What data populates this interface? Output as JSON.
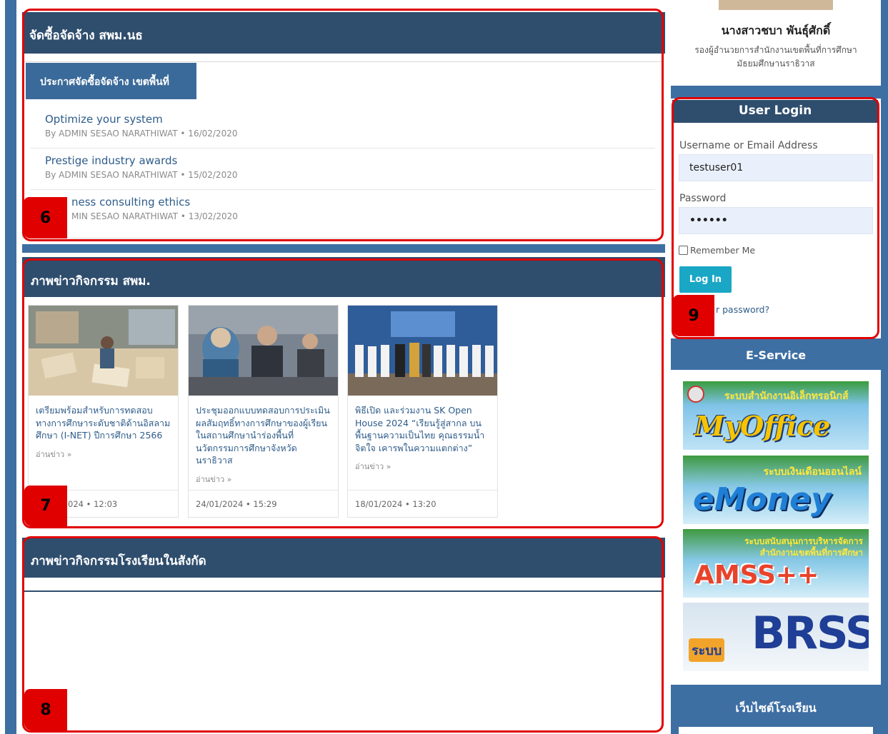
{
  "procurement": {
    "title": "จัดซื้อจัดจ้าง สพม.นธ",
    "tab": "ประกาศจัดซื้อจัดจ้าง เขตพื้นที่",
    "posts": [
      {
        "title": "Optimize your system",
        "meta": "By ADMIN SESAO NARATHIWAT • 16/02/2020"
      },
      {
        "title": "Prestige industry awards",
        "meta": "By ADMIN SESAO NARATHIWAT • 15/02/2020"
      },
      {
        "title": "ness consulting ethics",
        "meta": "MIN SESAO NARATHIWAT • 13/02/2020"
      }
    ],
    "badge": "6"
  },
  "news": {
    "title": "ภาพข่าวกิจกรรม สพม.",
    "badge": "7",
    "cards": [
      {
        "title": "เตรียมพร้อมสำหรับการทดสอบทางการศึกษาระดับชาติด้านอิสลามศึกษา (I-NET) ปีการศึกษา 2566",
        "more": "อ่านข่าว »",
        "date": "024",
        "time": "12:03"
      },
      {
        "title": "ประชุมออกแบบทดสอบการประเมินผลสัมฤทธิ์ทางการศึกษาของผู้เรียนในสถานศึกษานำร่องพื้นที่นวัตกรรมการศึกษาจังหวัดนราธิวาส",
        "more": "อ่านข่าว »",
        "date": "24/01/2024",
        "time": "15:29"
      },
      {
        "title": "พิธีเปิด และร่วมงาน SK Open House 2024 “เรียนรู้สู่สากล บนพื้นฐานความเป็นไทย คุณธรรมน้ำจิตใจ เคารพในความแตกต่าง”",
        "more": "อ่านข่าว »",
        "date": "18/01/2024",
        "time": "13:20"
      }
    ]
  },
  "schools": {
    "title": "ภาพข่าวกิจกรรมโรงเรียนในสังกัด",
    "badge": "8"
  },
  "profile": {
    "name": "นางสาวชบา พันธุ์ศักดิ์",
    "role_line1": "รองผู้อำนวยการสำนักงานเขตพื้นที่การศึกษา",
    "role_line2": "มัธยมศึกษานราธิวาส"
  },
  "login": {
    "title": "User Login",
    "username_label": "Username or Email Address",
    "username_value": "testuser01",
    "password_label": "Password",
    "password_value": "••••••",
    "remember_label": "Remember Me",
    "login_button": "Log In",
    "forgot_link": "r password?",
    "badge": "9"
  },
  "eservice": {
    "title": "E-Service",
    "myoffice_caption": "ระบบสำนักงานอิเล็กทรอนิกส์",
    "myoffice_logo": "MyOffice",
    "emoney_caption": "ระบบเงินเดือนออนไลน์",
    "emoney_logo": "eMoney",
    "amss_caption_1": "ระบบสนับสนุนการบริหารจัดการ",
    "amss_caption_2": "สำนักงานเขตพื้นที่การศึกษา",
    "amss_logo": "AMSS++",
    "brss_prefix": "ระบบ",
    "brss_logo": "BRSS"
  },
  "school_sites": {
    "title": "เว็บไซต์โรงเรียน"
  },
  "colors": {
    "accent_bar": "#2f4e6e",
    "side_bar": "#3e6fa3",
    "highlight": "#e00000",
    "login_button": "#1aa7c6"
  }
}
